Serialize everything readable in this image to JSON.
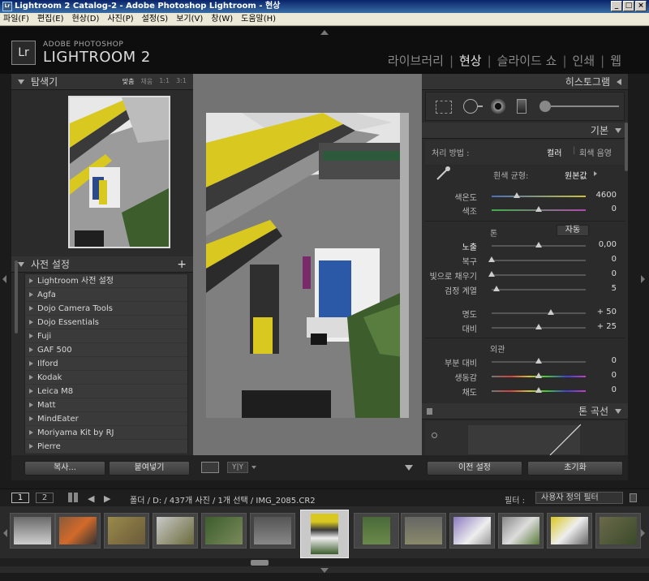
{
  "window": {
    "title": "Lightroom 2 Catalog-2 - Adobe Photoshop Lightroom - 현상",
    "app_icon": "Lr"
  },
  "menu": [
    "파일(F)",
    "편집(E)",
    "현상(D)",
    "사진(P)",
    "설정(S)",
    "보기(V)",
    "창(W)",
    "도움말(H)"
  ],
  "brand": {
    "logo": "Lr",
    "line1": "ADOBE PHOTOSHOP",
    "line2": "LIGHTROOM 2"
  },
  "modules": {
    "library": "라이브러리",
    "develop": "현상",
    "slideshow": "슬라이드 쇼",
    "print": "인쇄",
    "web": "웹",
    "sep": "|"
  },
  "navigator": {
    "title": "탐색기",
    "opt_fit": "맞춤",
    "opt_fill": "채움",
    "opt_1_1": "1:1",
    "opt_3_1": "3:1"
  },
  "presets": {
    "title": "사전 설정",
    "add": "+",
    "items": [
      "Lightroom 사전 설정",
      "Agfa",
      "Dojo Camera Tools",
      "Dojo Essentials",
      "Fuji",
      "GAF 500",
      "Ilford",
      "Kodak",
      "Leica M8",
      "Matt",
      "MindEater",
      "Moriyama Kit by RJ",
      "Pierre"
    ]
  },
  "left_buttons": {
    "copy": "복사...",
    "paste": "붙여넣기"
  },
  "toolbar": {
    "yy": "Y|Y"
  },
  "histogram": {
    "title": "히스토그램"
  },
  "basic": {
    "title": "기본",
    "treatment_label": "처리 방법 :",
    "color": "컬러",
    "bw": "회색 음영",
    "wb_label": "흰색 균형:",
    "wb_value": "원본값",
    "temp": {
      "label": "색온도",
      "value": "4600",
      "pos": 0.27
    },
    "tint": {
      "label": "색조",
      "value": "0",
      "pos": 0.5
    },
    "tone_title": "톤",
    "auto": "자동",
    "exposure": {
      "label": "노출",
      "value": "0,00",
      "pos": 0.5
    },
    "recovery": {
      "label": "복구",
      "value": "0",
      "pos": 0.0
    },
    "fill": {
      "label": "빛으로 채우기",
      "value": "0",
      "pos": 0.0
    },
    "blacks": {
      "label": "검정 계열",
      "value": "5",
      "pos": 0.05
    },
    "brightness": {
      "label": "명도",
      "value": "+ 50",
      "pos": 0.63
    },
    "contrast": {
      "label": "대비",
      "value": "+ 25",
      "pos": 0.5
    },
    "presence_title": "외관",
    "clarity": {
      "label": "부분 대비",
      "value": "0",
      "pos": 0.5
    },
    "vibrance": {
      "label": "생동감",
      "value": "0",
      "pos": 0.5
    },
    "saturation": {
      "label": "채도",
      "value": "0",
      "pos": 0.5
    }
  },
  "tonecurve": {
    "title": "톤 곡선"
  },
  "right_buttons": {
    "previous": "이전 설정",
    "reset": "초기화"
  },
  "filmstrip_bar": {
    "view1": "1",
    "view2": "2",
    "path": "폴더 / D: / 437개 사진 / 1개 선택 / IMG_2085.CR2",
    "filter_label": "필터 :",
    "filter_value": "사용자 정의 필터"
  },
  "colors": {
    "accent": "#dcdcdc",
    "panel": "#2b2b2b",
    "center": "#737373"
  }
}
